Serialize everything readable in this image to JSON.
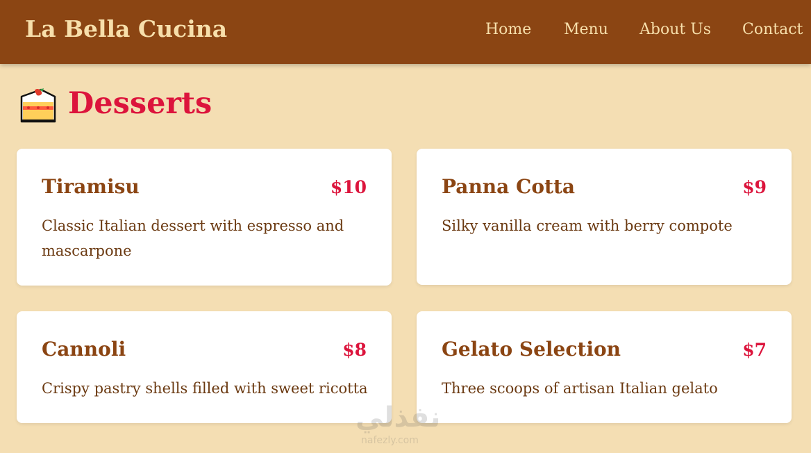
{
  "header": {
    "brand": "La Bella Cucina",
    "nav": [
      "Home",
      "Menu",
      "About Us",
      "Contact"
    ]
  },
  "section": {
    "title": "Desserts",
    "icon": "cake-slice-icon"
  },
  "items": [
    {
      "name": "Tiramisu",
      "price": "$10",
      "description": "Classic Italian dessert with espresso and mascarpone"
    },
    {
      "name": "Panna Cotta",
      "price": "$9",
      "description": "Silky vanilla cream with berry compote"
    },
    {
      "name": "Cannoli",
      "price": "$8",
      "description": "Crispy pastry shells filled with sweet ricotta"
    },
    {
      "name": "Gelato Selection",
      "price": "$7",
      "description": "Three scoops of artisan Italian gelato"
    }
  ],
  "watermark": {
    "text": "نفذلي",
    "subtext": "nafezly.com"
  },
  "colors": {
    "header_bg": "#8b4513",
    "page_bg": "#f4deb3",
    "accent": "#dc143c",
    "heading_brown": "#8b4513"
  }
}
